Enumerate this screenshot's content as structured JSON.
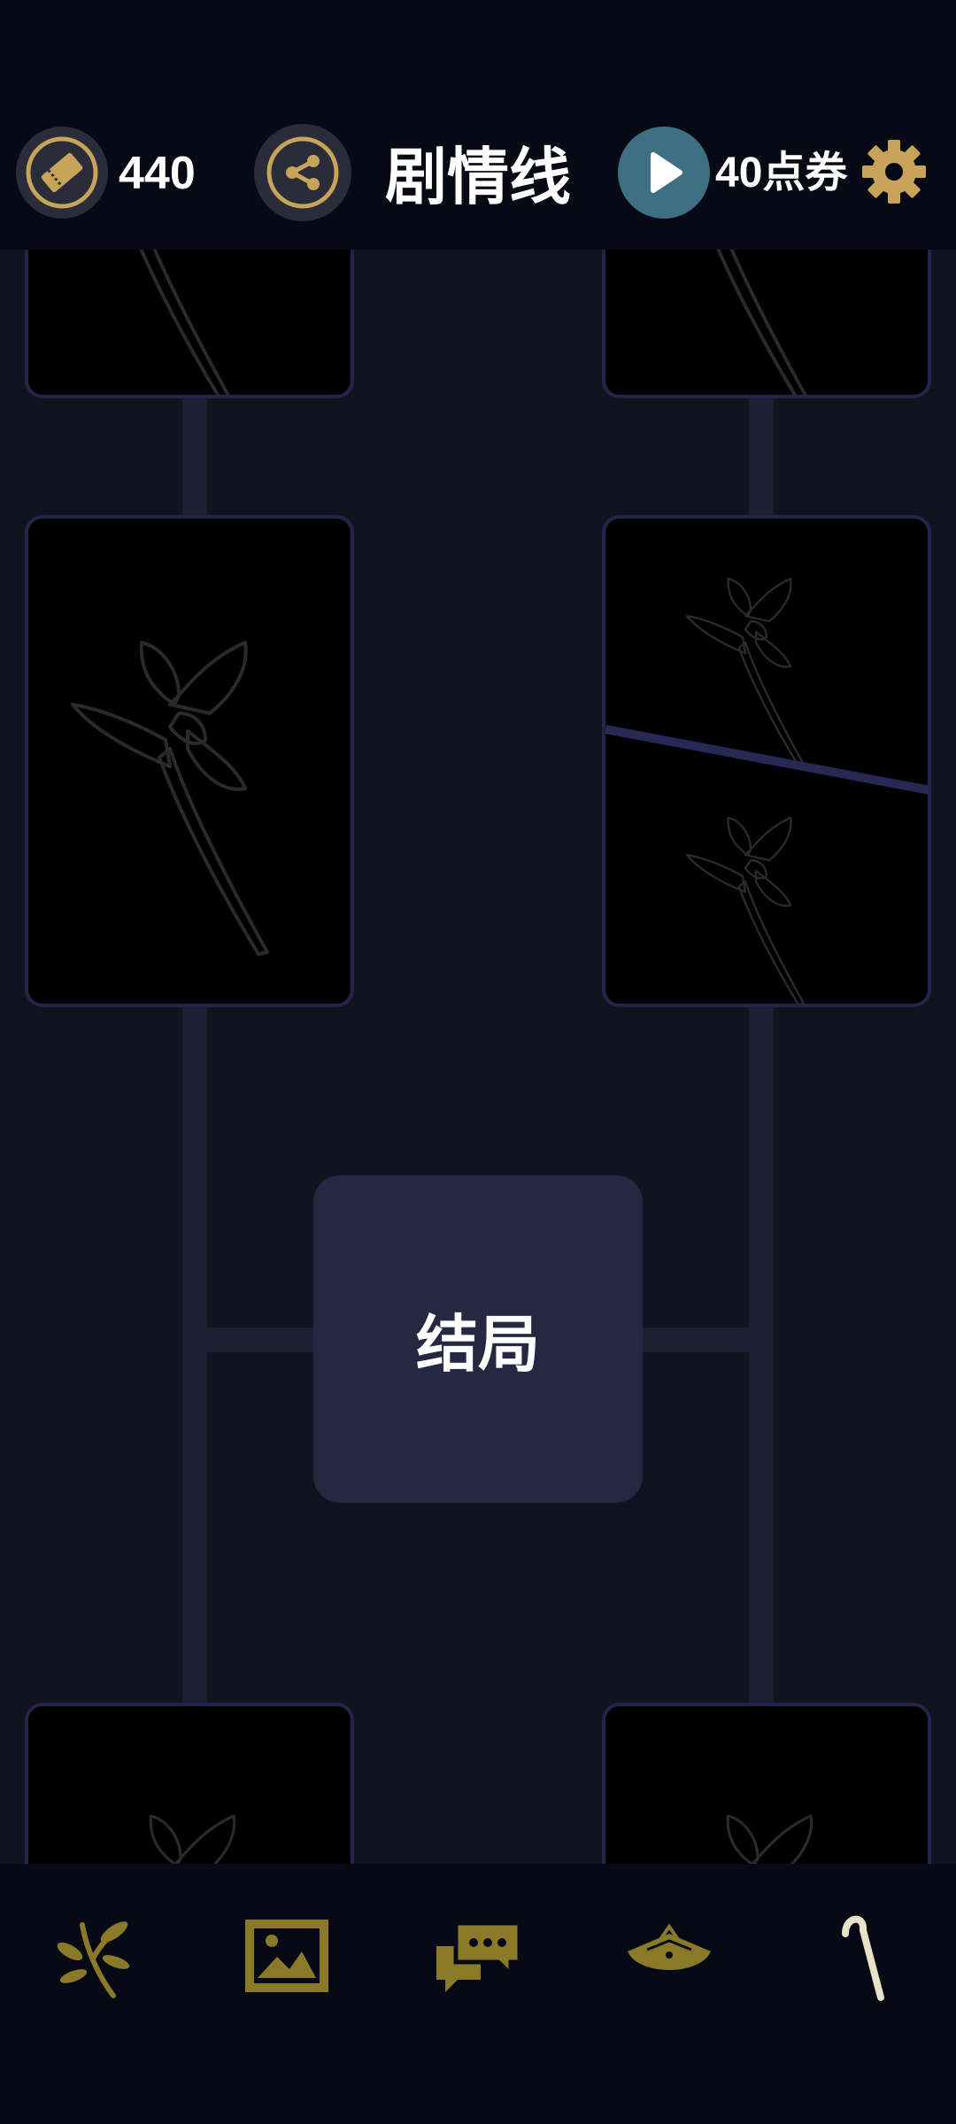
{
  "header": {
    "ticket_count": "440",
    "title": "剧情线",
    "points_label": "40点券",
    "icons": {
      "ticket": "ticket-icon",
      "share": "share-icon",
      "play": "play-icon",
      "settings": "gear-icon"
    }
  },
  "story": {
    "ending_label": "结局",
    "cards": [
      {
        "id": "card-top-left",
        "state": "locked",
        "art": "flower-silhouette"
      },
      {
        "id": "card-top-right",
        "state": "locked",
        "art": "flower-silhouette"
      },
      {
        "id": "card-mid-left",
        "state": "locked",
        "art": "flower-silhouette"
      },
      {
        "id": "card-mid-right",
        "state": "locked",
        "art": "two-flower-panels"
      },
      {
        "id": "card-bottom-left",
        "state": "locked",
        "art": "flower-silhouette"
      },
      {
        "id": "card-bottom-right",
        "state": "locked",
        "art": "flower-silhouette"
      }
    ]
  },
  "bottom_nav": {
    "items": [
      {
        "name": "branch-icon"
      },
      {
        "name": "gallery-icon"
      },
      {
        "name": "chat-icon"
      },
      {
        "name": "fan-icon"
      },
      {
        "name": "cane-icon"
      }
    ]
  },
  "colors": {
    "background": "#12131e",
    "bar": "#070a14",
    "gold": "#c8a45a",
    "olive": "#8a7a28",
    "ending_node": "#262842",
    "card_border": "#23244a",
    "play_button": "#3f6f82"
  }
}
